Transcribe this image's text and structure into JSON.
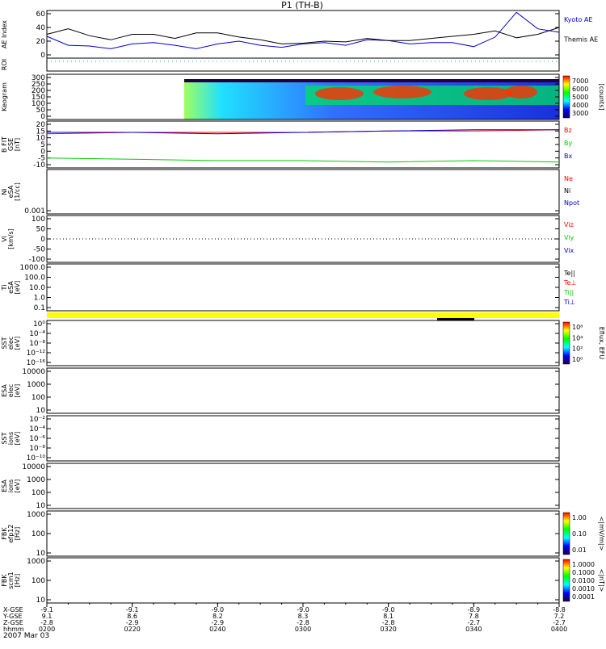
{
  "title": "P1 (TH-B)",
  "date_label": "2007 Mar 03",
  "colors": {
    "red": "#ff0000",
    "green": "#00cc00",
    "blue": "#0000cc",
    "black": "#000000",
    "cyan": "#00b0a0",
    "yellow": "#ffff00"
  },
  "panels": [
    {
      "id": "ae",
      "ylabel_lines": [
        "AE Index"
      ],
      "yticks": [
        "60",
        "40",
        "20",
        "0"
      ],
      "legend": [
        {
          "text": "Kyoto AE",
          "color": "blue"
        },
        {
          "text": "Themis AE",
          "color": "black"
        }
      ]
    },
    {
      "id": "roi",
      "ylabel_lines": [
        "ROI"
      ],
      "yticks": [],
      "legend": []
    },
    {
      "id": "keo",
      "ylabel_lines": [
        "Keogram"
      ],
      "yticks": [
        "300",
        "250",
        "200",
        "150",
        "100",
        "50",
        "0"
      ],
      "legend": [],
      "colorbar": {
        "ticks": [
          "7000",
          "6000",
          "5000",
          "4000",
          "3000"
        ],
        "label": "[counts]",
        "type": "keogram"
      }
    },
    {
      "id": "bfit",
      "ylabel_lines": [
        "B FIT",
        "GSE",
        "[nT]"
      ],
      "yticks": [
        "20",
        "15",
        "10",
        "5",
        "0",
        "-5",
        "-10"
      ],
      "legend": [
        {
          "text": "Bz",
          "color": "red"
        },
        {
          "text": "By",
          "color": "green"
        },
        {
          "text": "Bx",
          "color": "blue"
        }
      ]
    },
    {
      "id": "ni",
      "ylabel_lines": [
        "Ni",
        "eSA",
        "[1/cc]"
      ],
      "yticks": [
        "0.001"
      ],
      "legend": [
        {
          "text": "Ne",
          "color": "red"
        },
        {
          "text": "Ni",
          "color": "black"
        },
        {
          "text": "Npot",
          "color": "blue"
        }
      ]
    },
    {
      "id": "vi",
      "ylabel_lines": [
        "Vi",
        "[km/s]"
      ],
      "yticks": [
        "100",
        "50",
        "0",
        "-50",
        "-100"
      ],
      "legend": [
        {
          "text": "Viz",
          "color": "red"
        },
        {
          "text": "Viy",
          "color": "green"
        },
        {
          "text": "Vix",
          "color": "blue"
        }
      ]
    },
    {
      "id": "ti",
      "ylabel_lines": [
        "Ti",
        "eSA",
        "[eV]"
      ],
      "yticks": [
        "1000.0",
        "100.0",
        "10.0",
        "1.0",
        "0.1"
      ],
      "legend": [
        {
          "text": "Te||",
          "color": "black"
        },
        {
          "text": "Te⊥",
          "color": "red"
        },
        {
          "text": "Ti||",
          "color": "green"
        },
        {
          "text": "Ti⊥",
          "color": "blue"
        }
      ]
    },
    {
      "id": "sst_e",
      "ylabel_lines": [
        "SST",
        "elec",
        "[eV]"
      ],
      "yticks": [
        "10⁰",
        "10⁻⁴",
        "10⁻⁸",
        "10⁻¹²",
        "10⁻¹⁶"
      ],
      "legend": [],
      "colorbar": {
        "ticks": [
          "10⁸",
          "10⁴",
          "10²",
          "10⁰"
        ],
        "label": "Eflux, EFU",
        "type": "rainbow"
      }
    },
    {
      "id": "esa_e",
      "ylabel_lines": [
        "ESA",
        "elec",
        "[eV]"
      ],
      "yticks": [
        "10000",
        "1000",
        "100",
        "10"
      ],
      "legend": []
    },
    {
      "id": "sst_i",
      "ylabel_lines": [
        "SST",
        "ions",
        "[eV]"
      ],
      "yticks": [
        "10⁻²",
        "10⁻⁴",
        "10⁻⁶",
        "10⁻⁸",
        "10⁻¹⁰"
      ],
      "legend": []
    },
    {
      "id": "esa_i",
      "ylabel_lines": [
        "ESA",
        "ions",
        "[eV]"
      ],
      "yticks": [
        "10000",
        "1000",
        "100",
        "10"
      ],
      "legend": []
    },
    {
      "id": "fbk1",
      "ylabel_lines": [
        "FBK",
        "efp12",
        "[Hz]"
      ],
      "yticks": [
        "1000",
        "100",
        "10"
      ],
      "legend": [],
      "colorbar": {
        "ticks": [
          "1.00",
          "0.10",
          "0.01"
        ],
        "label": "<|mV/m|>",
        "type": "rainbow"
      }
    },
    {
      "id": "fbk2",
      "ylabel_lines": [
        "FBK",
        "scm1",
        "[Hz]"
      ],
      "yticks": [
        "1000",
        "100",
        "10"
      ],
      "legend": [],
      "colorbar": {
        "ticks": [
          "1.0000",
          "0.1000",
          "0.0100",
          "0.0010",
          "0.0001"
        ],
        "label": "<|nT|>",
        "type": "rainbow"
      }
    }
  ],
  "xaxis": {
    "row_labels": [
      "X-GSE",
      "Y-GSE",
      "Z-GSE",
      "hhmm"
    ],
    "ticks": [
      {
        "x": "-9.1",
        "y": "9.1",
        "z": "-2.8",
        "t": "0200"
      },
      {
        "x": "-9.1",
        "y": "8.6",
        "z": "-2.9",
        "t": "0220"
      },
      {
        "x": "-9.0",
        "y": "8.2",
        "z": "-2.9",
        "t": "0240"
      },
      {
        "x": "-9.0",
        "y": "8.3",
        "z": "-2.8",
        "t": "0300"
      },
      {
        "x": "-9.0",
        "y": "8.1",
        "z": "-2.8",
        "t": "0320"
      },
      {
        "x": "-8.9",
        "y": "7.8",
        "z": "-2.7",
        "t": "0340"
      },
      {
        "x": "-8.8",
        "y": "7.2",
        "z": "-2.7",
        "t": "0400"
      }
    ]
  },
  "chart_data": {
    "type": "line",
    "title": "P1 (TH-B)",
    "x_unit": "hhmm",
    "time_minutes_after": "02:00",
    "series": [
      {
        "name": "Kyoto AE",
        "panel": "ae",
        "color": "blue",
        "t": [
          0,
          5,
          10,
          15,
          20,
          25,
          30,
          35,
          40,
          45,
          50,
          55,
          60,
          65,
          70,
          75,
          80,
          85,
          90,
          95,
          100,
          105,
          110,
          115,
          120
        ],
        "v": [
          27,
          14,
          13,
          9,
          16,
          18,
          14,
          9,
          16,
          20,
          14,
          11,
          16,
          18,
          14,
          22,
          21,
          16,
          18,
          18,
          12,
          26,
          62,
          38,
          33
        ]
      },
      {
        "name": "Themis AE",
        "panel": "ae",
        "color": "black",
        "t": [
          0,
          5,
          10,
          15,
          20,
          25,
          30,
          35,
          40,
          45,
          50,
          55,
          60,
          65,
          70,
          75,
          80,
          85,
          90,
          95,
          100,
          105,
          110,
          115,
          120
        ],
        "v": [
          30,
          38,
          28,
          22,
          30,
          30,
          24,
          32,
          32,
          26,
          22,
          16,
          17,
          20,
          19,
          24,
          21,
          21,
          24,
          27,
          30,
          35,
          25,
          30,
          40
        ]
      },
      {
        "name": "Bz",
        "panel": "bfit",
        "color": "red",
        "t": [
          0,
          20,
          40,
          60,
          80,
          100,
          120
        ],
        "v": [
          13,
          14,
          14,
          14,
          15,
          15,
          16
        ]
      },
      {
        "name": "By",
        "panel": "bfit",
        "color": "green",
        "t": [
          0,
          20,
          40,
          60,
          80,
          100,
          120
        ],
        "v": [
          -5,
          -6,
          -7,
          -7,
          -8,
          -7,
          -8
        ]
      },
      {
        "name": "Bx",
        "panel": "bfit",
        "color": "blue",
        "t": [
          0,
          20,
          40,
          60,
          80,
          100,
          120
        ],
        "v": [
          14,
          14,
          13,
          14,
          15,
          16,
          16
        ]
      }
    ],
    "ylims": {
      "ae": [
        0,
        60
      ],
      "bfit": [
        -10,
        20
      ],
      "vi": [
        -100,
        100
      ],
      "keogram": [
        0,
        300
      ]
    }
  }
}
